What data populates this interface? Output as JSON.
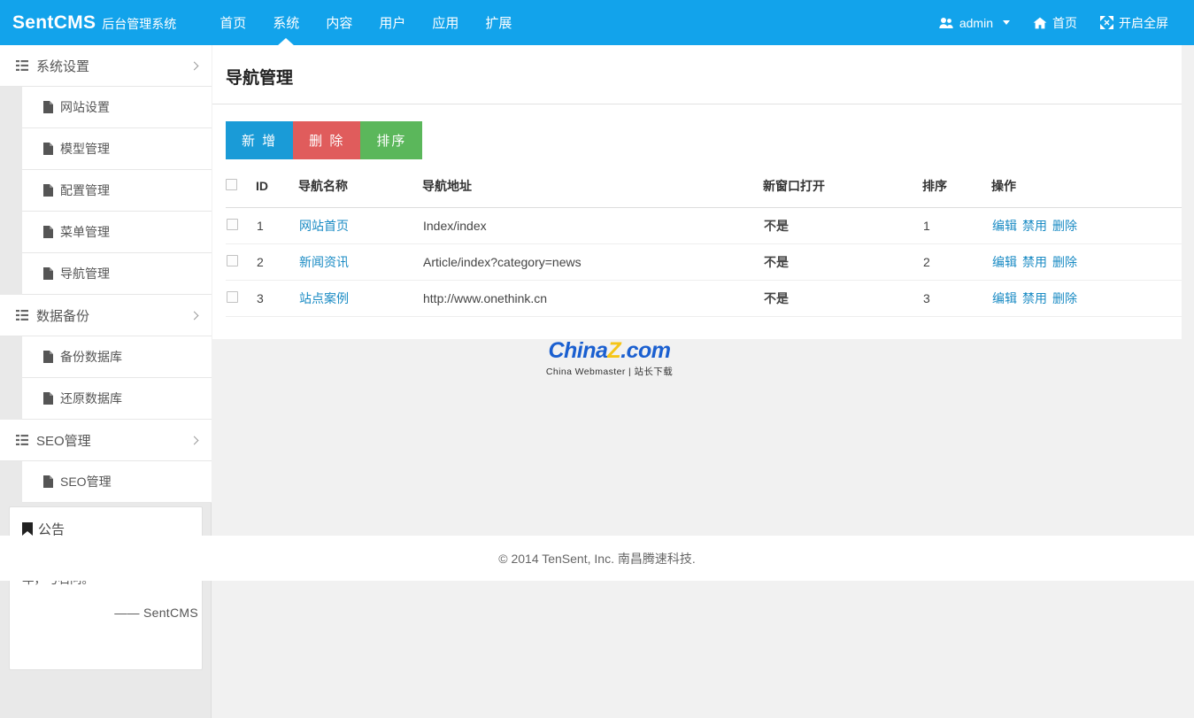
{
  "navbar": {
    "brand_name": "SentCMS",
    "brand_sub": "后台管理系统",
    "menu": [
      {
        "label": "首页",
        "active": false
      },
      {
        "label": "系统",
        "active": true
      },
      {
        "label": "内容",
        "active": false
      },
      {
        "label": "用户",
        "active": false
      },
      {
        "label": "应用",
        "active": false
      },
      {
        "label": "扩展",
        "active": false
      }
    ],
    "right": {
      "user": "admin",
      "home": "首页",
      "fullscreen": "开启全屏"
    },
    "bg_color": "#12a3eb"
  },
  "sidebar": {
    "groups": [
      {
        "label": "系统设置",
        "items": [
          {
            "label": "网站设置"
          },
          {
            "label": "模型管理"
          },
          {
            "label": "配置管理"
          },
          {
            "label": "菜单管理"
          },
          {
            "label": "导航管理"
          }
        ]
      },
      {
        "label": "数据备份",
        "items": [
          {
            "label": "备份数据库"
          },
          {
            "label": "还原数据库"
          }
        ]
      },
      {
        "label": "SEO管理",
        "items": [
          {
            "label": "SEO管理"
          }
        ]
      }
    ],
    "announcement": {
      "title": "公告",
      "body": "年，弓石问。",
      "signature": "—— SentCMS"
    }
  },
  "main": {
    "page_title": "导航管理",
    "buttons": {
      "add": "新 增",
      "delete": "删 除",
      "sort": "排序",
      "add_color": "#1a9bd7",
      "delete_color": "#e05c5c",
      "sort_color": "#5bb75b"
    },
    "table": {
      "headers": {
        "id": "ID",
        "name": "导航名称",
        "url": "导航地址",
        "new_window": "新窗口打开",
        "sort": "排序",
        "ops": "操作"
      },
      "rows": [
        {
          "id": "1",
          "name": "网站首页",
          "url": "Index/index",
          "new_window": "不是",
          "sort": "1",
          "ops": {
            "edit": "编辑",
            "disable": "禁用",
            "delete": "删除"
          }
        },
        {
          "id": "2",
          "name": "新闻资讯",
          "url": "Article/index?category=news",
          "new_window": "不是",
          "sort": "2",
          "ops": {
            "edit": "编辑",
            "disable": "禁用",
            "delete": "删除"
          }
        },
        {
          "id": "3",
          "name": "站点案例",
          "url": "http://www.onethink.cn",
          "new_window": "不是",
          "sort": "3",
          "ops": {
            "edit": "编辑",
            "disable": "禁用",
            "delete": "删除"
          }
        }
      ]
    },
    "watermark": {
      "part1": "China",
      "part2": "Z",
      "part3": ".com",
      "tagline": "China Webmaster | 站长下载",
      "color_blue": "#1a5fd0",
      "color_yellow": "#f5c518"
    }
  },
  "footer": {
    "text": "© 2014 TenSent, Inc. 南昌腾速科技."
  }
}
